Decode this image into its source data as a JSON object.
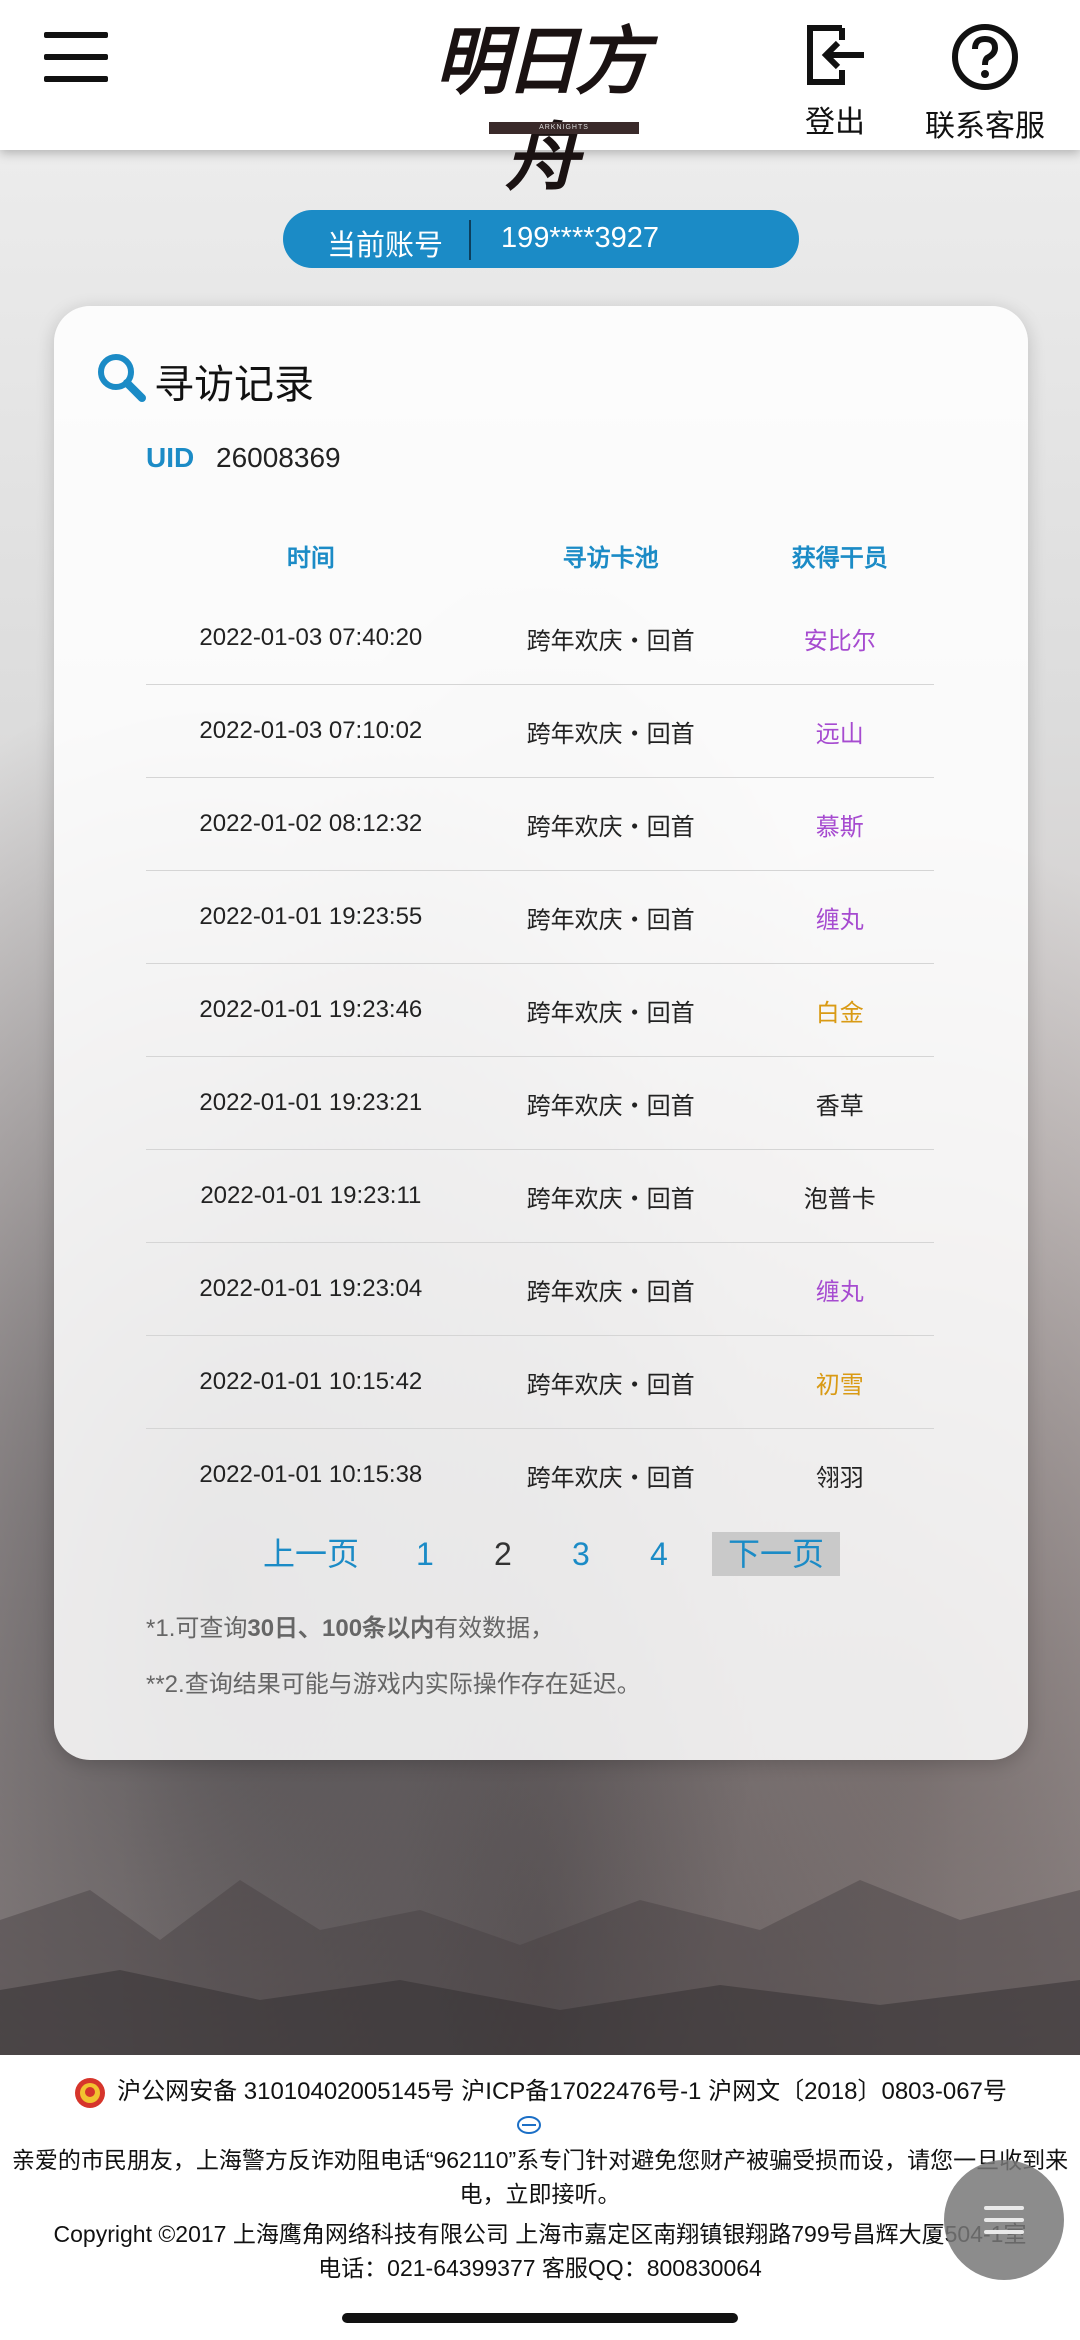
{
  "header": {
    "logo_text": "明日方舟",
    "logo_sub": "ARKNIGHTS",
    "logout_label": "登出",
    "support_label": "联系客服"
  },
  "account": {
    "label": "当前账号",
    "number": "199****3927"
  },
  "records": {
    "title": "寻访记录",
    "uid_label": "UID",
    "uid_value": "26008369",
    "columns": [
      "时间",
      "寻访卡池",
      "获得干员"
    ],
    "rows": [
      {
        "time": "2022-01-03 07:40:20",
        "pool": "跨年欢庆・回首",
        "operator": "安比尔",
        "color": "#a64bd0"
      },
      {
        "time": "2022-01-03 07:10:02",
        "pool": "跨年欢庆・回首",
        "operator": "远山",
        "color": "#a64bd0"
      },
      {
        "time": "2022-01-02 08:12:32",
        "pool": "跨年欢庆・回首",
        "operator": "慕斯",
        "color": "#a64bd0"
      },
      {
        "time": "2022-01-01 19:23:55",
        "pool": "跨年欢庆・回首",
        "operator": "缠丸",
        "color": "#a64bd0"
      },
      {
        "time": "2022-01-01 19:23:46",
        "pool": "跨年欢庆・回首",
        "operator": "白金",
        "color": "#d99a14"
      },
      {
        "time": "2022-01-01 19:23:21",
        "pool": "跨年欢庆・回首",
        "operator": "香草",
        "color": "#222222"
      },
      {
        "time": "2022-01-01 19:23:11",
        "pool": "跨年欢庆・回首",
        "operator": "泡普卡",
        "color": "#222222"
      },
      {
        "time": "2022-01-01 19:23:04",
        "pool": "跨年欢庆・回首",
        "operator": "缠丸",
        "color": "#a64bd0"
      },
      {
        "time": "2022-01-01 10:15:42",
        "pool": "跨年欢庆・回首",
        "operator": "初雪",
        "color": "#d99a14"
      },
      {
        "time": "2022-01-01 10:15:38",
        "pool": "跨年欢庆・回首",
        "operator": "翎羽",
        "color": "#222222"
      }
    ]
  },
  "pager": {
    "prev": "上一页",
    "pages": [
      "1",
      "2",
      "3",
      "4"
    ],
    "current_page": "2",
    "next": "下一页"
  },
  "notes": {
    "note1_prefix": "*1.可查询",
    "note1_bold": "30日、100条以内",
    "note1_suffix": "有效数据，",
    "note2": "**2.查询结果可能与游戏内实际操作存在延迟。"
  },
  "footer": {
    "registration": "沪公网安备 31010402005145号  沪ICP备17022476号-1  沪网文〔2018〕0803-067号",
    "notice": "亲爱的市民朋友，上海警方反诈劝阻电话“962110”系专门针对避免您财产被骗受损而设，请您一旦收到来电，立即接听。",
    "copyright": "Copyright ©2017 上海鹰角网络科技有限公司  上海市嘉定区南翔镇银翔路799号昌辉大厦504-1室",
    "contact": "电话：021-64399377 客服QQ：800830064"
  },
  "colors": {
    "accent": "#1b8bc6",
    "rare_purple": "#a64bd0",
    "rare_gold": "#d99a14"
  },
  "icons": [
    "menu-icon",
    "logout-icon",
    "help-icon",
    "search-icon",
    "police-badge-icon",
    "floating-menu-icon"
  ]
}
